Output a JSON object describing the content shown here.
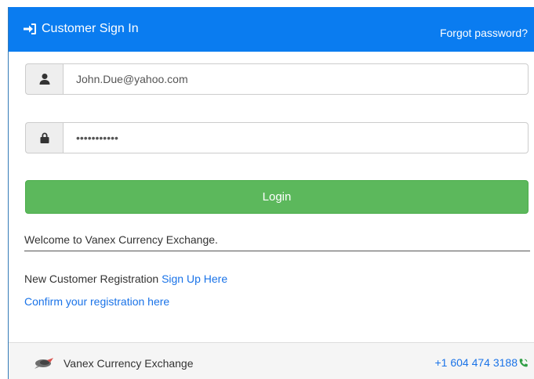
{
  "header": {
    "title": "Customer Sign In",
    "forgot_password": "Forgot password?",
    "background_color": "#0a7cf0"
  },
  "form": {
    "username_value": "John.Due@yahoo.com",
    "password_value": "password123",
    "login_label": "Login",
    "login_color": "#5cb85c"
  },
  "welcome": {
    "text": "Welcome to Vanex Currency Exchange."
  },
  "registration": {
    "prefix": "New Customer Registration ",
    "signup_link": "Sign Up Here",
    "confirm_link": "Confirm your registration here",
    "link_color": "#1a73e8"
  },
  "footer": {
    "brand": "Vanex Currency Exchange",
    "phone": "+1 604 474 3188",
    "phone_icon_color": "#2e9e44"
  },
  "icons": {
    "signin": "sign-in-icon",
    "user": "user-icon",
    "lock": "lock-icon",
    "logo": "logo-icon",
    "phone": "phone-icon"
  }
}
